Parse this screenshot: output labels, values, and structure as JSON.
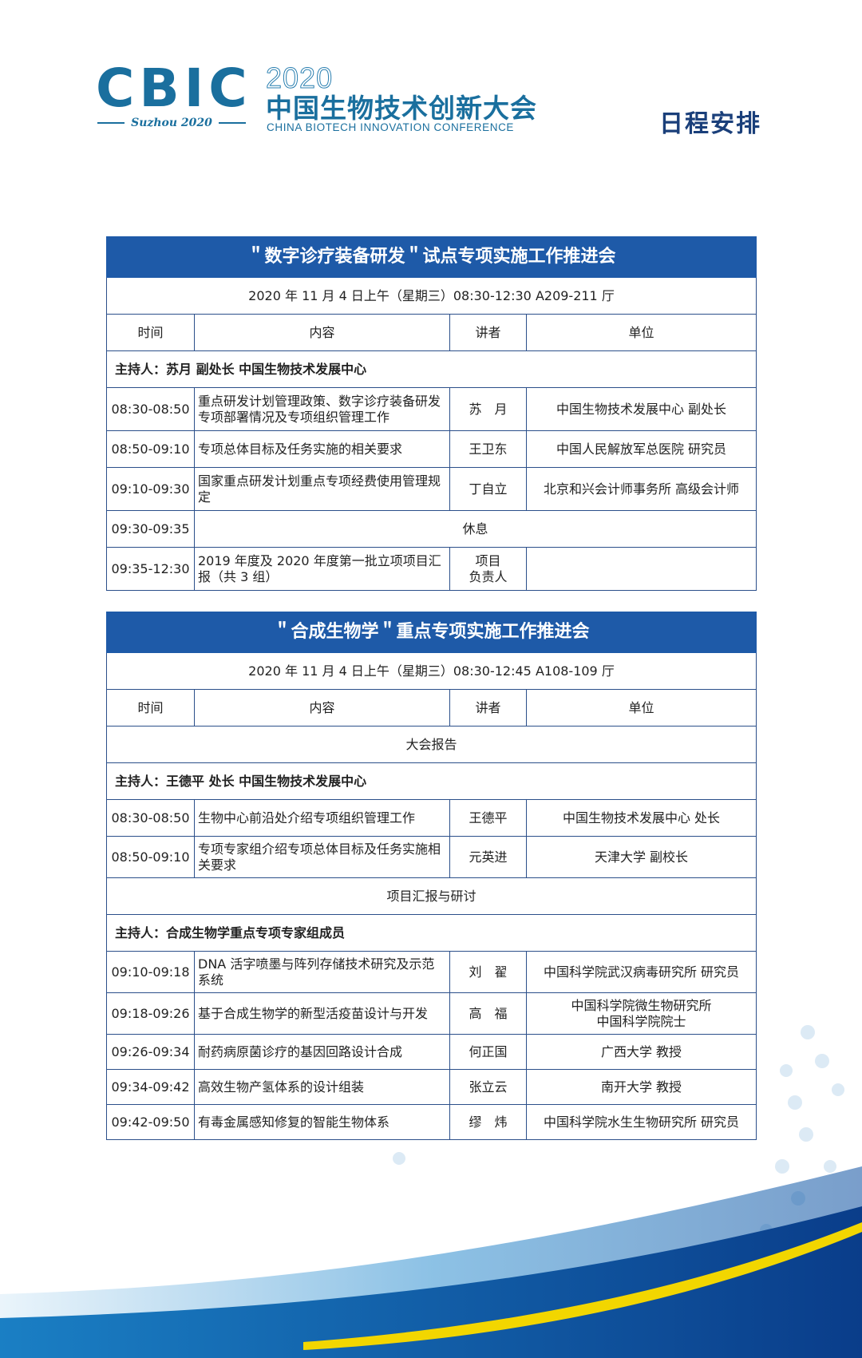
{
  "header": {
    "logo_text": "CBIC",
    "logo_sub": "Suzhou 2020",
    "year": "2020",
    "conference_cn": "中国生物技术创新大会",
    "conference_en": "CHINA BIOTECH INNOVATION CONFERENCE",
    "page_title": "日程安排"
  },
  "colors": {
    "brand_blue": "#1a6f9e",
    "title_bar": "#1e5aa8",
    "border": "#2b4f8a",
    "accent_yellow": "#f2d600"
  },
  "column_headers": {
    "time": "时间",
    "content": "内容",
    "speaker": "讲者",
    "unit": "单位"
  },
  "session1": {
    "title": "＂数字诊疗装备研发＂试点专项实施工作推进会",
    "datetime": "2020 年 11 月 4 日上午（星期三）08:30-12:30 A209-211 厅",
    "host": "主持人：苏月 副处长 中国生物技术发展中心",
    "rows": [
      {
        "time": "08:30-08:50",
        "content": "重点研发计划管理政策、数字诊疗装备研发专项部署情况及专项组织管理工作",
        "speaker": "苏　月",
        "unit": "中国生物技术发展中心  副处长"
      },
      {
        "time": "08:50-09:10",
        "content": "专项总体目标及任务实施的相关要求",
        "speaker": "王卫东",
        "unit": "中国人民解放军总医院  研究员"
      },
      {
        "time": "09:10-09:30",
        "content": "国家重点研发计划重点专项经费使用管理规定",
        "speaker": "丁自立",
        "unit": "北京和兴会计师事务所  高级会计师"
      }
    ],
    "break": {
      "time": "09:30-09:35",
      "label": "休息"
    },
    "last": {
      "time": "09:35-12:30",
      "content": "2019 年度及 2020 年度第一批立项项目汇报（共 3 组）",
      "speaker": "项目\n负责人",
      "unit": ""
    }
  },
  "session2": {
    "title": "＂合成生物学＂重点专项实施工作推进会",
    "datetime": "2020 年 11 月 4 日上午（星期三）08:30-12:45 A108-109 厅",
    "section1": "大会报告",
    "host1": "主持人：王德平 处长 中国生物技术发展中心",
    "rows1": [
      {
        "time": "08:30-08:50",
        "content": "生物中心前沿处介绍专项组织管理工作",
        "speaker": "王德平",
        "unit": "中国生物技术发展中心  处长"
      },
      {
        "time": "08:50-09:10",
        "content": "专项专家组介绍专项总体目标及任务实施相关要求",
        "speaker": "元英进",
        "unit": "天津大学  副校长"
      }
    ],
    "section2": "项目汇报与研讨",
    "host2": "主持人：合成生物学重点专项专家组成员",
    "rows2": [
      {
        "time": "09:10-09:18",
        "content": "DNA 活字喷墨与阵列存储技术研究及示范系统",
        "speaker": "刘　翟",
        "unit": "中国科学院武汉病毒研究所  研究员"
      },
      {
        "time": "09:18-09:26",
        "content": "基于合成生物学的新型活疫苗设计与开发",
        "speaker": "高　福",
        "unit": "中国科学院微生物研究所\n中国科学院院士"
      },
      {
        "time": "09:26-09:34",
        "content": "耐药病原菌诊疗的基因回路设计合成",
        "speaker": "何正国",
        "unit": "广西大学 教授"
      },
      {
        "time": "09:34-09:42",
        "content": "高效生物产氢体系的设计组装",
        "speaker": "张立云",
        "unit": "南开大学 教授"
      },
      {
        "time": "09:42-09:50",
        "content": "有毒金属感知修复的智能生物体系",
        "speaker": "缪　炜",
        "unit": "中国科学院水生生物研究所  研究员"
      }
    ]
  }
}
